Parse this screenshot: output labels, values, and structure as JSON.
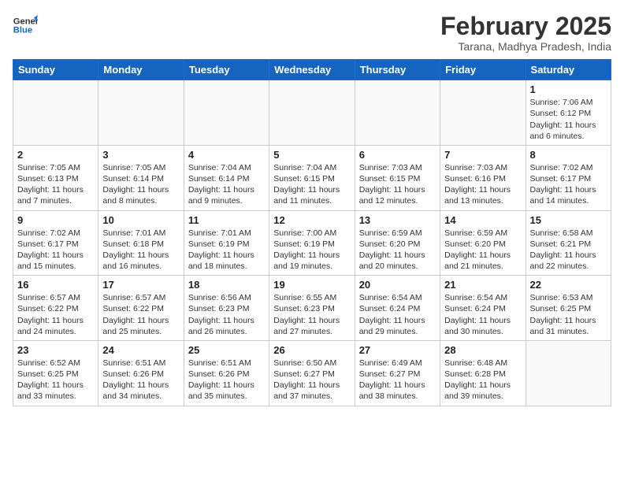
{
  "logo": {
    "line1": "General",
    "line2": "Blue"
  },
  "title": "February 2025",
  "subtitle": "Tarana, Madhya Pradesh, India",
  "weekdays": [
    "Sunday",
    "Monday",
    "Tuesday",
    "Wednesday",
    "Thursday",
    "Friday",
    "Saturday"
  ],
  "weeks": [
    [
      {
        "day": "",
        "info": ""
      },
      {
        "day": "",
        "info": ""
      },
      {
        "day": "",
        "info": ""
      },
      {
        "day": "",
        "info": ""
      },
      {
        "day": "",
        "info": ""
      },
      {
        "day": "",
        "info": ""
      },
      {
        "day": "1",
        "info": "Sunrise: 7:06 AM\nSunset: 6:12 PM\nDaylight: 11 hours and 6 minutes."
      }
    ],
    [
      {
        "day": "2",
        "info": "Sunrise: 7:05 AM\nSunset: 6:13 PM\nDaylight: 11 hours and 7 minutes."
      },
      {
        "day": "3",
        "info": "Sunrise: 7:05 AM\nSunset: 6:14 PM\nDaylight: 11 hours and 8 minutes."
      },
      {
        "day": "4",
        "info": "Sunrise: 7:04 AM\nSunset: 6:14 PM\nDaylight: 11 hours and 9 minutes."
      },
      {
        "day": "5",
        "info": "Sunrise: 7:04 AM\nSunset: 6:15 PM\nDaylight: 11 hours and 11 minutes."
      },
      {
        "day": "6",
        "info": "Sunrise: 7:03 AM\nSunset: 6:15 PM\nDaylight: 11 hours and 12 minutes."
      },
      {
        "day": "7",
        "info": "Sunrise: 7:03 AM\nSunset: 6:16 PM\nDaylight: 11 hours and 13 minutes."
      },
      {
        "day": "8",
        "info": "Sunrise: 7:02 AM\nSunset: 6:17 PM\nDaylight: 11 hours and 14 minutes."
      }
    ],
    [
      {
        "day": "9",
        "info": "Sunrise: 7:02 AM\nSunset: 6:17 PM\nDaylight: 11 hours and 15 minutes."
      },
      {
        "day": "10",
        "info": "Sunrise: 7:01 AM\nSunset: 6:18 PM\nDaylight: 11 hours and 16 minutes."
      },
      {
        "day": "11",
        "info": "Sunrise: 7:01 AM\nSunset: 6:19 PM\nDaylight: 11 hours and 18 minutes."
      },
      {
        "day": "12",
        "info": "Sunrise: 7:00 AM\nSunset: 6:19 PM\nDaylight: 11 hours and 19 minutes."
      },
      {
        "day": "13",
        "info": "Sunrise: 6:59 AM\nSunset: 6:20 PM\nDaylight: 11 hours and 20 minutes."
      },
      {
        "day": "14",
        "info": "Sunrise: 6:59 AM\nSunset: 6:20 PM\nDaylight: 11 hours and 21 minutes."
      },
      {
        "day": "15",
        "info": "Sunrise: 6:58 AM\nSunset: 6:21 PM\nDaylight: 11 hours and 22 minutes."
      }
    ],
    [
      {
        "day": "16",
        "info": "Sunrise: 6:57 AM\nSunset: 6:22 PM\nDaylight: 11 hours and 24 minutes."
      },
      {
        "day": "17",
        "info": "Sunrise: 6:57 AM\nSunset: 6:22 PM\nDaylight: 11 hours and 25 minutes."
      },
      {
        "day": "18",
        "info": "Sunrise: 6:56 AM\nSunset: 6:23 PM\nDaylight: 11 hours and 26 minutes."
      },
      {
        "day": "19",
        "info": "Sunrise: 6:55 AM\nSunset: 6:23 PM\nDaylight: 11 hours and 27 minutes."
      },
      {
        "day": "20",
        "info": "Sunrise: 6:54 AM\nSunset: 6:24 PM\nDaylight: 11 hours and 29 minutes."
      },
      {
        "day": "21",
        "info": "Sunrise: 6:54 AM\nSunset: 6:24 PM\nDaylight: 11 hours and 30 minutes."
      },
      {
        "day": "22",
        "info": "Sunrise: 6:53 AM\nSunset: 6:25 PM\nDaylight: 11 hours and 31 minutes."
      }
    ],
    [
      {
        "day": "23",
        "info": "Sunrise: 6:52 AM\nSunset: 6:25 PM\nDaylight: 11 hours and 33 minutes."
      },
      {
        "day": "24",
        "info": "Sunrise: 6:51 AM\nSunset: 6:26 PM\nDaylight: 11 hours and 34 minutes."
      },
      {
        "day": "25",
        "info": "Sunrise: 6:51 AM\nSunset: 6:26 PM\nDaylight: 11 hours and 35 minutes."
      },
      {
        "day": "26",
        "info": "Sunrise: 6:50 AM\nSunset: 6:27 PM\nDaylight: 11 hours and 37 minutes."
      },
      {
        "day": "27",
        "info": "Sunrise: 6:49 AM\nSunset: 6:27 PM\nDaylight: 11 hours and 38 minutes."
      },
      {
        "day": "28",
        "info": "Sunrise: 6:48 AM\nSunset: 6:28 PM\nDaylight: 11 hours and 39 minutes."
      },
      {
        "day": "",
        "info": ""
      }
    ]
  ]
}
